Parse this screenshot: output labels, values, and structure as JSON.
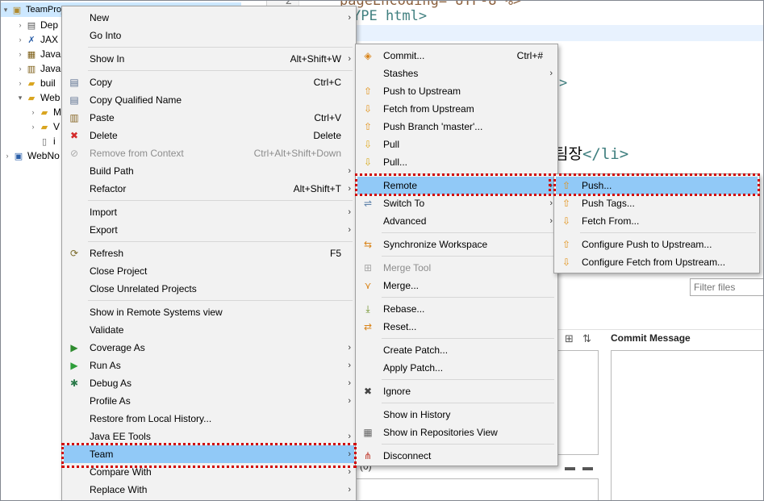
{
  "tree": {
    "project": "TeamProject1 [TeamProject1 Repository master]",
    "items": [
      "Dep",
      "JAX",
      "Java",
      "Java",
      "buil",
      "Web",
      "M",
      "V",
      "i",
      "WebNo"
    ]
  },
  "editor": {
    "line_number": "2",
    "line1": "pageEncoding=\"UTF-8\"%>",
    "line2": "YPE html>",
    "line3": ">",
    "line4": "팀장</li>"
  },
  "staging": {
    "filter_placeholder": "Filter files",
    "commit_message_label": "Commit Message",
    "count": "(0)"
  },
  "context_menu": [
    {
      "label": "New",
      "arrow": true,
      "icon": ""
    },
    {
      "label": "Go Into",
      "icon": ""
    },
    {
      "label": "Show In",
      "shortcut": "Alt+Shift+W",
      "arrow": true,
      "icon": ""
    },
    {
      "label": "Copy",
      "shortcut": "Ctrl+C",
      "icon": "copy-icon"
    },
    {
      "label": "Copy Qualified Name",
      "icon": "copy-qualified-icon"
    },
    {
      "label": "Paste",
      "shortcut": "Ctrl+V",
      "icon": "paste-icon"
    },
    {
      "label": "Delete",
      "shortcut": "Delete",
      "icon": "delete-icon"
    },
    {
      "label": "Remove from Context",
      "shortcut": "Ctrl+Alt+Shift+Down",
      "disabled": true,
      "icon": "remove-context-icon"
    },
    {
      "label": "Build Path",
      "arrow": true,
      "icon": ""
    },
    {
      "label": "Refactor",
      "shortcut": "Alt+Shift+T",
      "arrow": true,
      "icon": ""
    },
    {
      "label": "Import",
      "arrow": true,
      "icon": ""
    },
    {
      "label": "Export",
      "arrow": true,
      "icon": ""
    },
    {
      "label": "Refresh",
      "shortcut": "F5",
      "icon": "refresh-icon"
    },
    {
      "label": "Close Project",
      "icon": ""
    },
    {
      "label": "Close Unrelated Projects",
      "icon": ""
    },
    {
      "label": "Show in Remote Systems view",
      "icon": ""
    },
    {
      "label": "Validate",
      "icon": ""
    },
    {
      "label": "Coverage As",
      "arrow": true,
      "icon": "coverage-icon"
    },
    {
      "label": "Run As",
      "arrow": true,
      "icon": "run-icon"
    },
    {
      "label": "Debug As",
      "arrow": true,
      "icon": "debug-icon"
    },
    {
      "label": "Profile As",
      "arrow": true,
      "icon": ""
    },
    {
      "label": "Restore from Local History...",
      "icon": ""
    },
    {
      "label": "Java EE Tools",
      "arrow": true,
      "icon": ""
    },
    {
      "label": "Team",
      "arrow": true,
      "icon": "",
      "highlighted": true
    },
    {
      "label": "Compare With",
      "arrow": true,
      "icon": ""
    },
    {
      "label": "Replace With",
      "arrow": true,
      "icon": ""
    }
  ],
  "team_menu": [
    {
      "label": "Commit...",
      "shortcut": "Ctrl+#",
      "icon": "commit-icon"
    },
    {
      "label": "Stashes",
      "arrow": true,
      "icon": ""
    },
    {
      "label": "Push to Upstream",
      "icon": "push-upstream-icon"
    },
    {
      "label": "Fetch from Upstream",
      "icon": "fetch-upstream-icon"
    },
    {
      "label": "Push Branch 'master'...",
      "icon": "push-branch-icon"
    },
    {
      "label": "Pull",
      "icon": "pull-icon"
    },
    {
      "label": "Pull...",
      "icon": "pull-dialog-icon"
    },
    {
      "label": "Remote",
      "arrow": true,
      "icon": "",
      "highlighted": true
    },
    {
      "label": "Switch To",
      "arrow": true,
      "icon": "switch-icon"
    },
    {
      "label": "Advanced",
      "arrow": true,
      "icon": ""
    },
    {
      "label": "Synchronize Workspace",
      "icon": "synchronize-icon"
    },
    {
      "label": "Merge Tool",
      "disabled": true,
      "icon": "merge-tool-icon"
    },
    {
      "label": "Merge...",
      "icon": "merge-icon"
    },
    {
      "label": "Rebase...",
      "icon": "rebase-icon"
    },
    {
      "label": "Reset...",
      "icon": "reset-icon"
    },
    {
      "label": "Create Patch...",
      "icon": ""
    },
    {
      "label": "Apply Patch...",
      "icon": ""
    },
    {
      "label": "Ignore",
      "icon": "ignore-icon"
    },
    {
      "label": "Show in History",
      "icon": ""
    },
    {
      "label": "Show in Repositories View",
      "icon": "git-repo-icon"
    },
    {
      "label": "Disconnect",
      "icon": "disconnect-icon"
    }
  ],
  "remote_menu": [
    {
      "label": "Push...",
      "icon": "push-icon",
      "highlighted": true
    },
    {
      "label": "Push Tags...",
      "icon": "push-tags-icon"
    },
    {
      "label": "Fetch From...",
      "icon": "fetch-icon"
    },
    {
      "label": "Configure Push to Upstream...",
      "icon": "configure-push-icon"
    },
    {
      "label": "Configure Fetch from Upstream...",
      "icon": "configure-fetch-icon"
    }
  ]
}
